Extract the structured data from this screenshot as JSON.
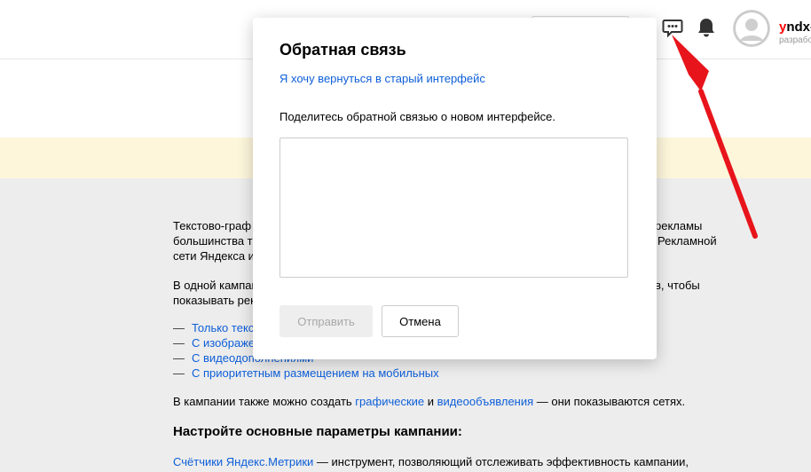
{
  "header": {
    "user": {
      "name_first": "y",
      "name_rest": "ndx-",
      "subtitle": "разрабо"
    },
    "icons": {
      "feedback": "chat-dots-icon",
      "notifications": "bell-icon",
      "avatar": "user-avatar-icon"
    }
  },
  "content": {
    "p1": [
      "Текстово-граф",
      "рекламы",
      "большинства т",
      "Рекламной",
      "сети Яндекса и"
    ],
    "p2": [
      "В одной кампан",
      "в, чтобы",
      "показывать рек"
    ],
    "list": [
      "Только текс",
      "С изображе",
      "С видеодополнениями",
      "С приоритетным размещением на мобильных"
    ],
    "list_dash": "—",
    "p3": {
      "before": "В кампании также можно создать ",
      "link1": "графические",
      "mid": " и ",
      "link2": "видеообъявления",
      "after": " — они показываются сетях."
    },
    "heading": "Настройте основные параметры кампании:",
    "p4": {
      "link": "Счётчики Яндекс.Метрики",
      "text": " — инструмент, позволяющий отслеживать эффективность кампании,"
    }
  },
  "modal": {
    "title": "Обратная связь",
    "link": "Я хочу вернуться в старый интерфейс",
    "description": "Поделитесь обратной связью о новом интерфейсе.",
    "textarea_value": "",
    "send_label": "Отправить",
    "cancel_label": "Отмена"
  },
  "colors": {
    "link": "#0e5fd8",
    "arrow": "#e8141b",
    "yellow_band": "#fdf6db",
    "background": "#ededed"
  }
}
